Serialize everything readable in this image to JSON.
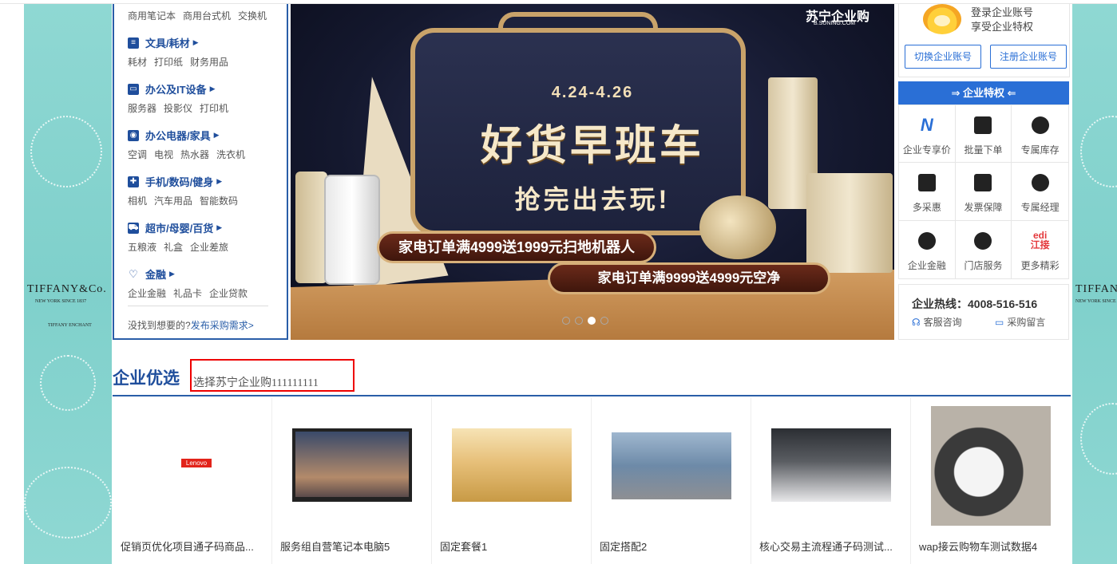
{
  "side_ads": {
    "brand": "TIFFANY&Co.",
    "tagline": "NEW YORK SINCE 1837",
    "sub": "TIFFANY ENCHANT"
  },
  "category_menu": {
    "top_sub": [
      "商用笔记本",
      "商用台式机",
      "交换机"
    ],
    "groups": [
      {
        "title": "文具/耗材",
        "items": [
          "耗材",
          "打印纸",
          "财务用品"
        ]
      },
      {
        "title": "办公及IT设备",
        "items": [
          "服务器",
          "投影仪",
          "打印机"
        ]
      },
      {
        "title": "办公电器/家具",
        "items": [
          "空调",
          "电视",
          "热水器",
          "洗衣机"
        ]
      },
      {
        "title": "手机/数码/健身",
        "items": [
          "相机",
          "汽车用品",
          "智能数码"
        ]
      },
      {
        "title": "超市/母婴/百货",
        "items": [
          "五粮液",
          "礼盒",
          "企业差旅"
        ]
      },
      {
        "title": "金融",
        "items": [
          "企业金融",
          "礼品卡",
          "企业贷款"
        ]
      }
    ],
    "more_prefix": "没找到想要的?",
    "more_link": "发布采购需求>"
  },
  "banner": {
    "brand": "苏宁企业购",
    "brand_sub": "B.SUNING.COM",
    "dates": "4.24-4.26",
    "headline": "好货早班车",
    "subline": "抢完出去玩!",
    "promo1": "家电订单满4999送1999元扫地机器人",
    "promo2": "家电订单满9999送4999元空净",
    "slides": 4,
    "active_slide": 3
  },
  "account": {
    "line1": "登录企业账号",
    "line2": "享受企业特权",
    "switch_btn": "切换企业账号",
    "register_btn": "注册企业账号"
  },
  "privileges": {
    "title": "企业特权",
    "items": [
      {
        "label": "企业专享价",
        "icon": "nv-logo-icon"
      },
      {
        "label": "批量下单",
        "icon": "gift-icon"
      },
      {
        "label": "专属库存",
        "icon": "headset-icon"
      },
      {
        "label": "多采惠",
        "icon": "chat-icon"
      },
      {
        "label": "发票保障",
        "icon": "printer-icon"
      },
      {
        "label": "专属经理",
        "icon": "headset-icon"
      },
      {
        "label": "企业金融",
        "icon": "headset-icon"
      },
      {
        "label": "门店服务",
        "icon": "headset-icon"
      },
      {
        "label": "更多精彩",
        "icon": "edi-logo-icon"
      }
    ],
    "edi_text": "edi 江接"
  },
  "hotline": {
    "title": "企业热线：4008-516-516",
    "service": "客服咨询",
    "message": "采购留言"
  },
  "section": {
    "title": "企业优选",
    "input_value": "选择苏宁企业购111111111"
  },
  "products": [
    {
      "name": "促销页优化项目通子码商品..."
    },
    {
      "name": "服务组自营笔记本电脑5"
    },
    {
      "name": "固定套餐1"
    },
    {
      "name": "固定搭配2"
    },
    {
      "name": "核心交易主流程通子码测试..."
    },
    {
      "name": "wap接云购物车测试数据4"
    }
  ],
  "lenovo_logo": "Lenovo"
}
